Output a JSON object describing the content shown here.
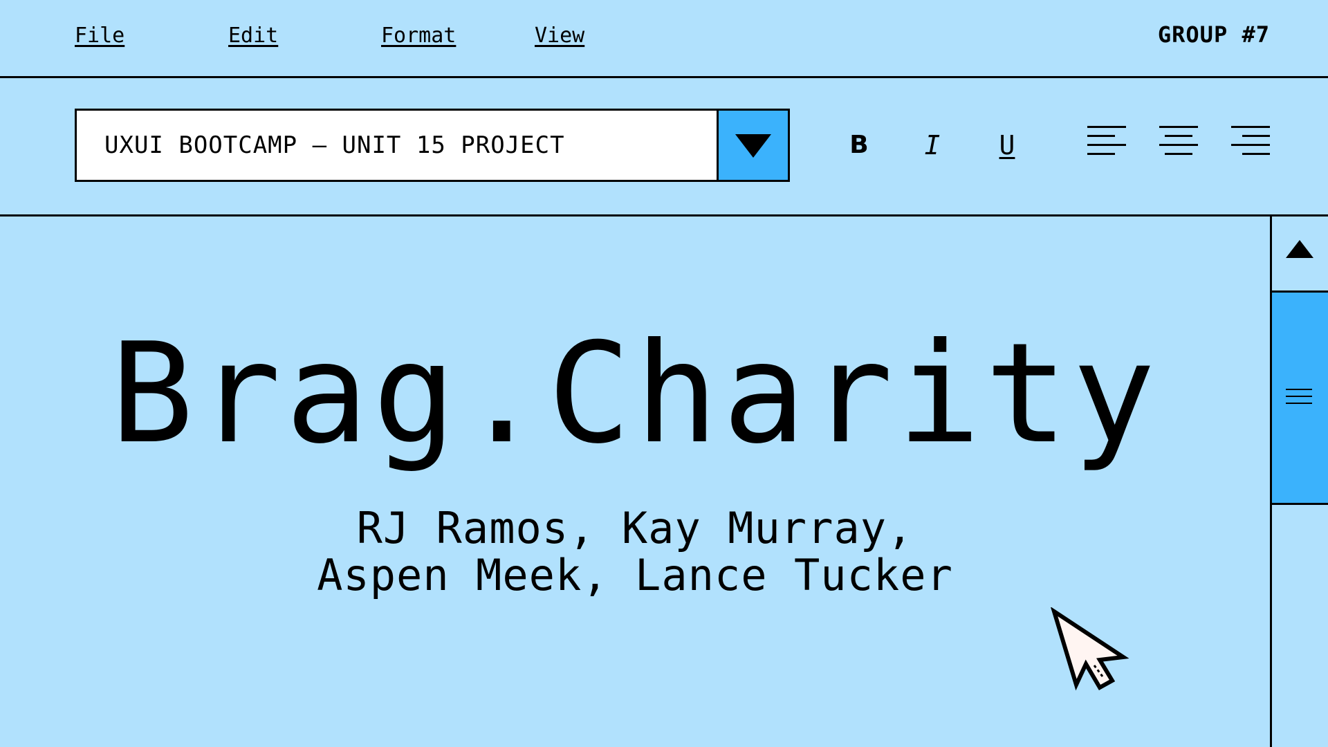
{
  "menu": {
    "file": "File",
    "edit": "Edit",
    "format": "Format",
    "view": "View"
  },
  "group_label": "GROUP #7",
  "toolbar": {
    "document_name": "UXUI BOOTCAMP – UNIT 15 PROJECT",
    "dropdown_icon": "triangle-down-icon",
    "bold": "B",
    "italic": "I",
    "underline": "U",
    "align_icons": [
      "align-left-icon",
      "align-center-icon",
      "align-right-icon"
    ]
  },
  "content": {
    "title": "Brag.Charity",
    "authors_line1": "RJ Ramos, Kay Murray,",
    "authors_line2": "Aspen Meek, Lance Tucker"
  },
  "colors": {
    "background": "#b1e1fd",
    "accent": "#3bb2fc",
    "text": "#000000"
  }
}
